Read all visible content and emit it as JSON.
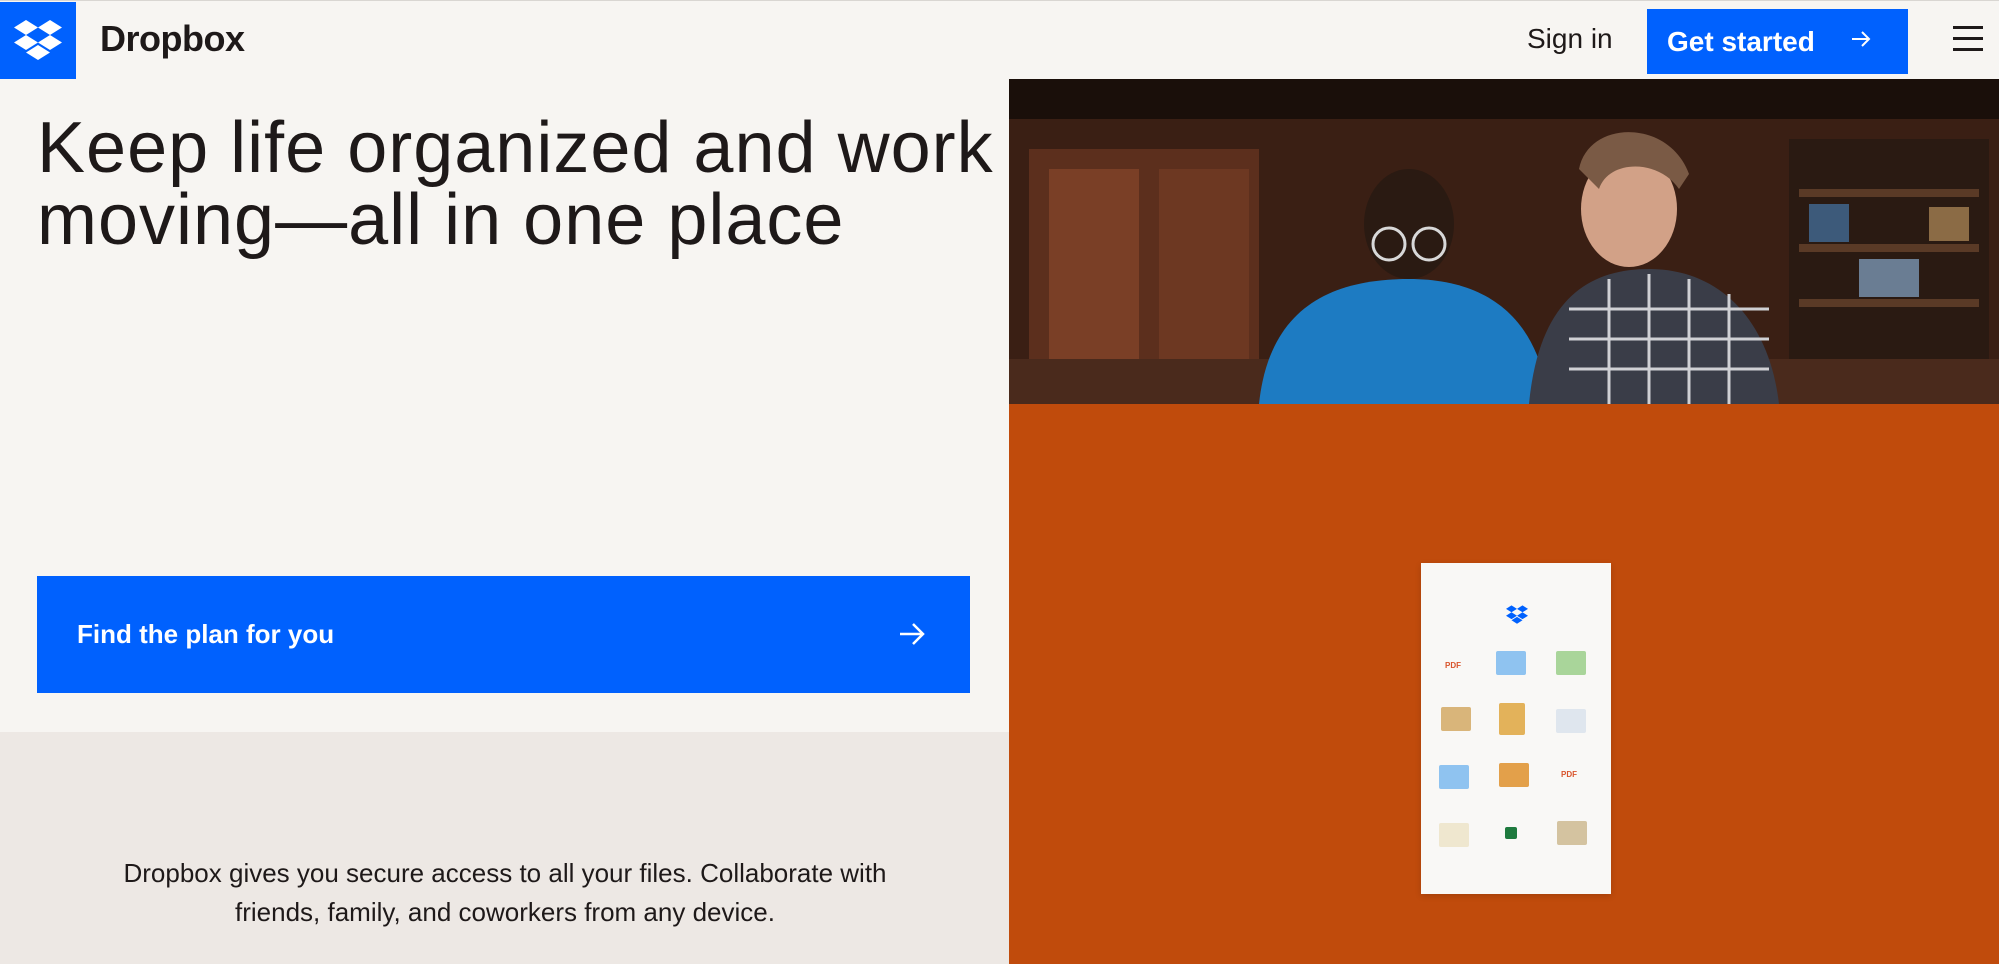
{
  "header": {
    "brand": "Dropbox",
    "sign_in": "Sign in",
    "get_started": "Get started"
  },
  "hero": {
    "headline": "Keep life organized and work moving—all in one place",
    "cta": "Find the plan for you",
    "description": "Dropbox gives you secure access to all your files. Collaborate with friends, family, and coworkers from any device."
  },
  "phone": {
    "pdf_label_1": "PDF",
    "pdf_label_2": "PDF"
  },
  "colors": {
    "accent": "#0061fe",
    "orange_panel": "#c04b0c",
    "background": "#f7f5f2",
    "beige_panel": "#ede8e4"
  },
  "icons": [
    "dropbox-logo-icon",
    "arrow-right-icon",
    "hamburger-menu-icon"
  ]
}
